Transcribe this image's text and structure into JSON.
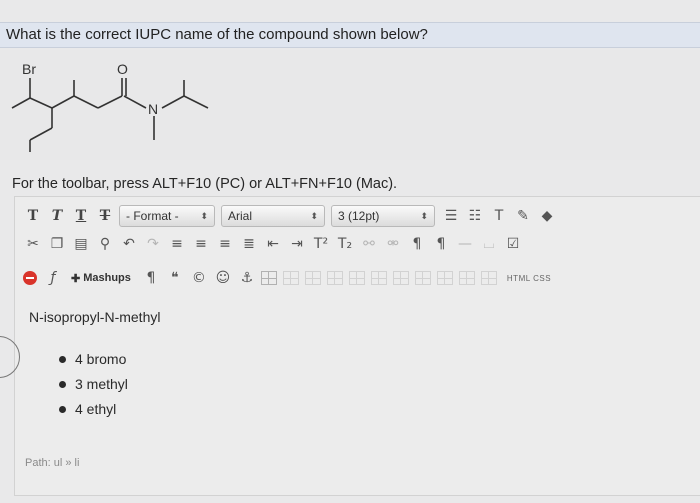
{
  "question": {
    "text": "What is the correct IUPC name of the compound shown below?"
  },
  "molecule": {
    "atom_labels": {
      "bromine": "Br",
      "oxygen": "O",
      "nitrogen": "N"
    }
  },
  "instruction": {
    "text": "For the toolbar, press ALT+F10 (PC) or ALT+FN+F10 (Mac)."
  },
  "toolbar": {
    "row1": {
      "text_buttons": [
        "T",
        "T",
        "T",
        "T"
      ],
      "format_label": "- Format -",
      "font_label": "Arial",
      "size_label": "3 (12pt)",
      "dropdown_arrow": "⬍"
    },
    "row3": {
      "mashups_label": "Mashups",
      "html_css_label": "HTML CSS"
    }
  },
  "editor": {
    "first_line": "N-isopropyl-N-methyl",
    "bullets": [
      "4 bromo",
      "3 methyl",
      "4 ethyl"
    ],
    "path_label": "Path: ul » li"
  }
}
